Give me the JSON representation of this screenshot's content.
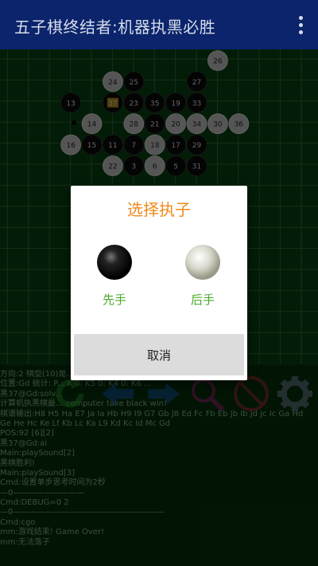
{
  "app": {
    "title": "五子棋终结者:机器执黑必胜"
  },
  "board": {
    "stones": [
      {
        "n": "26",
        "color": "white",
        "col": 11,
        "row": 0
      },
      {
        "n": "24",
        "color": "white",
        "col": 6,
        "row": 1
      },
      {
        "n": "25",
        "color": "black",
        "col": 7,
        "row": 1
      },
      {
        "n": "27",
        "color": "black",
        "col": 10,
        "row": 1
      },
      {
        "n": "13",
        "color": "black",
        "col": 4,
        "row": 2
      },
      {
        "n": "37",
        "color": "black",
        "col": 6,
        "row": 2,
        "marked": true
      },
      {
        "n": "23",
        "color": "black",
        "col": 7,
        "row": 2
      },
      {
        "n": "35",
        "color": "black",
        "col": 8,
        "row": 2
      },
      {
        "n": "19",
        "color": "black",
        "col": 9,
        "row": 2
      },
      {
        "n": "33",
        "color": "black",
        "col": 10,
        "row": 2
      },
      {
        "n": "14",
        "color": "white",
        "col": 5,
        "row": 3
      },
      {
        "n": "28",
        "color": "white",
        "col": 7,
        "row": 3
      },
      {
        "n": "21",
        "color": "black",
        "col": 8,
        "row": 3
      },
      {
        "n": "20",
        "color": "white",
        "col": 9,
        "row": 3
      },
      {
        "n": "34",
        "color": "white",
        "col": 10,
        "row": 3
      },
      {
        "n": "30",
        "color": "white",
        "col": 11,
        "row": 3
      },
      {
        "n": "36",
        "color": "white",
        "col": 12,
        "row": 3
      },
      {
        "n": "16",
        "color": "white",
        "col": 4,
        "row": 4
      },
      {
        "n": "15",
        "color": "black",
        "col": 5,
        "row": 4
      },
      {
        "n": "11",
        "color": "black",
        "col": 6,
        "row": 4
      },
      {
        "n": "7",
        "color": "black",
        "col": 7,
        "row": 4
      },
      {
        "n": "18",
        "color": "white",
        "col": 8,
        "row": 4
      },
      {
        "n": "17",
        "color": "black",
        "col": 9,
        "row": 4
      },
      {
        "n": "29",
        "color": "black",
        "col": 10,
        "row": 4
      },
      {
        "n": "22",
        "color": "white",
        "col": 6,
        "row": 5
      },
      {
        "n": "3",
        "color": "black",
        "col": 7,
        "row": 5
      },
      {
        "n": "6",
        "color": "white",
        "col": 8,
        "row": 5
      },
      {
        "n": "5",
        "color": "black",
        "col": 9,
        "row": 5
      },
      {
        "n": "31",
        "color": "black",
        "col": 10,
        "row": 5
      }
    ]
  },
  "dialog": {
    "title": "选择执子",
    "first_label": "先手",
    "second_label": "后手",
    "cancel_label": "取消"
  },
  "console": {
    "lines": [
      "方向:2 棋型(10)是...",
      "位置:Gd 统计: P... K 0: K5 0: K4 0: K6 ...",
      "黑37@Gd:solv...",
      "计算机执黑棋最... computer take black win!",
      "棋谱输出:H8 H5 Ha E7 Ja Ia Hb H9 I9 G7 Gb J8 Ed Fc Fb Eb Jb Ib Jd Jc Ic Ga Hd",
      "Ge He Hc Ke Lf Kb Lc Ka L9 Kd Kc Id Mc Gd",
      "POS:92 [6][2]",
      "黑37@Gd:ai",
      "Main:playSound[2]",
      "黑棋胜利!",
      "Main:playSound[3]",
      "Cmd:设置单步思考时间为2秒",
      "—0—————————",
      "Cmd:DEBUG=0 2",
      "—0———————————————————",
      "Cmd:cgo",
      "mm:游戏结束! Game Over!",
      "mm:无法落子"
    ]
  },
  "colors": {
    "appbar": "#0b246b",
    "board": "#073f10",
    "dialog_title": "#f08a1c",
    "choice_label": "#4caa2c"
  },
  "icons": [
    "refresh-icon",
    "back-arrow-icon",
    "forward-arrow-icon",
    "search-icon",
    "no-entry-icon",
    "gear-icon"
  ]
}
